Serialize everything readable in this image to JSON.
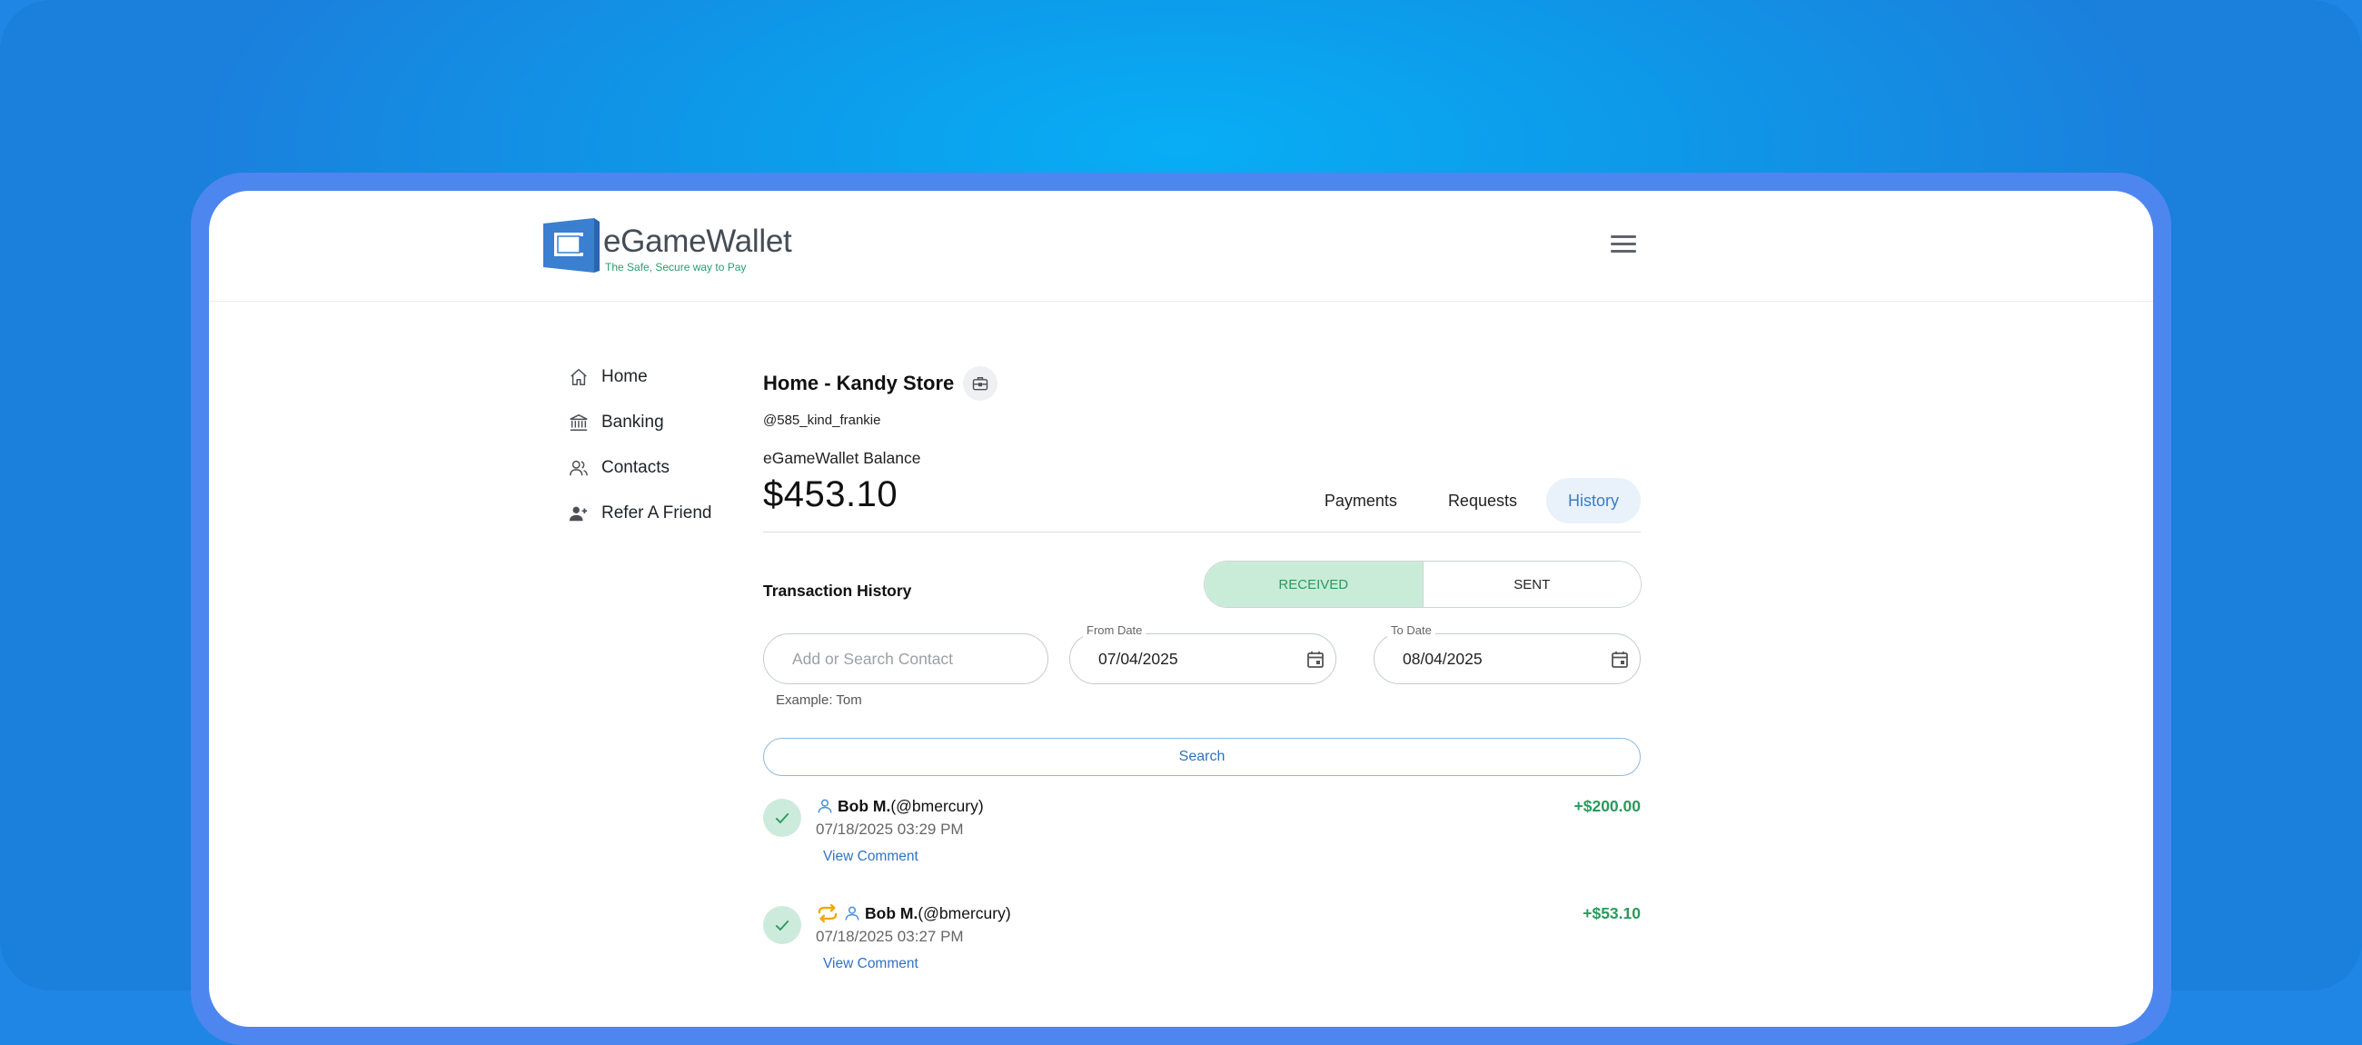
{
  "brand": {
    "name": "eGameWallet",
    "tagline": "The Safe, Secure way to Pay",
    "logo_color": "#3a7fd0",
    "tagline_color": "#2b9c6e"
  },
  "header": {
    "menu_icon": "hamburger-menu-icon"
  },
  "sidebar": {
    "items": [
      {
        "label": "Home",
        "icon": "home-icon"
      },
      {
        "label": "Banking",
        "icon": "bank-icon"
      },
      {
        "label": "Contacts",
        "icon": "contacts-icon"
      },
      {
        "label": "Refer A Friend",
        "icon": "add-user-icon"
      }
    ]
  },
  "main": {
    "title": "Home - Kandy Store",
    "title_icon": "briefcase-icon",
    "handle": "@585_kind_frankie",
    "balance_label": "eGameWallet Balance",
    "balance": "$453.10",
    "tabs": [
      {
        "label": "Payments",
        "active": false
      },
      {
        "label": "Requests",
        "active": false
      },
      {
        "label": "History",
        "active": true
      }
    ]
  },
  "history": {
    "label": "Transaction History",
    "toggle": {
      "received": "RECEIVED",
      "sent": "SENT",
      "selected": "RECEIVED"
    },
    "contact_search": {
      "placeholder": "Add or Search Contact",
      "value": "",
      "helper": "Example: Tom"
    },
    "from_date": {
      "label": "From Date",
      "value": "07/04/2025"
    },
    "to_date": {
      "label": "To Date",
      "value": "08/04/2025"
    },
    "search_label": "Search",
    "transactions": [
      {
        "name": "Bob M.",
        "handle": "(@bmercury)",
        "date": "07/18/2025 03:29 PM",
        "amount": "+$200.00",
        "comment_label": "View Comment",
        "recurring": false,
        "status_icon": "check-icon"
      },
      {
        "name": "Bob M.",
        "handle": "(@bmercury)",
        "date": "07/18/2025 03:27 PM",
        "amount": "+$53.10",
        "comment_label": "View Comment",
        "recurring": true,
        "status_icon": "check-icon"
      }
    ]
  },
  "colors": {
    "accent_blue": "#3b7dc4",
    "success_green": "#2a9a5c",
    "received_bg": "#c9ecd9",
    "frame_blue": "#4d86ee"
  }
}
